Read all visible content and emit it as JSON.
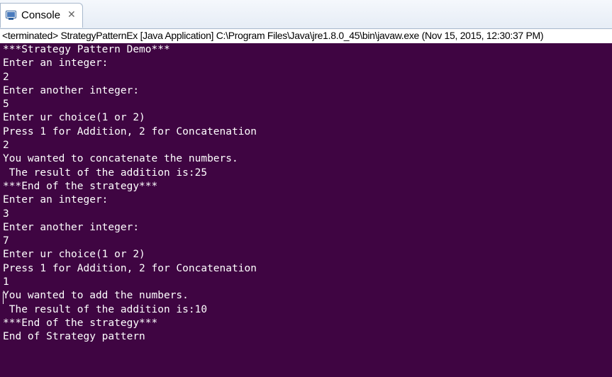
{
  "tab": {
    "icon": "console-icon",
    "label": "Console",
    "close": "✕"
  },
  "status": "<terminated> StrategyPatternEx [Java Application] C:\\Program Files\\Java\\jre1.8.0_45\\bin\\javaw.exe (Nov 15, 2015, 12:30:37 PM)",
  "colors": {
    "console_background": "#3f0542",
    "console_text": "#ffffff"
  },
  "console": {
    "lines": [
      "***Strategy Pattern Demo***",
      "Enter an integer:",
      "2",
      "Enter another integer:",
      "5",
      "Enter ur choice(1 or 2)",
      "Press 1 for Addition, 2 for Concatenation",
      "2",
      "You wanted to concatenate the numbers.",
      " The result of the addition is:25",
      "***End of the strategy***",
      "Enter an integer:",
      "3",
      "Enter another integer:",
      "7",
      "Enter ur choice(1 or 2)",
      "Press 1 for Addition, 2 for Concatenation",
      "1",
      "You wanted to add the numbers.",
      " The result of the addition is:10",
      "***End of the strategy***",
      "End of Strategy pattern"
    ]
  }
}
